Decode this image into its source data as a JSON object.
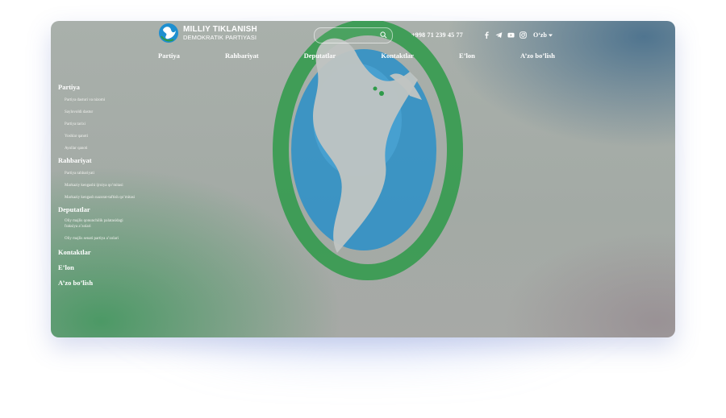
{
  "brand": {
    "name_line1": "MILLIY TIKLANISH",
    "name_line2": "DEMOKRATIK PARTIYASI"
  },
  "header": {
    "search_placeholder": "",
    "phone": "+998 71 239 45 77",
    "socials": [
      "facebook-icon",
      "telegram-icon",
      "youtube-icon",
      "instagram-icon"
    ],
    "language": "O‘zb"
  },
  "nav": {
    "items": [
      "Partiya",
      "Rahbariyat",
      "Deputatlar",
      "Kontaktlar",
      "E’lon",
      "A’zo bo’lish"
    ]
  },
  "sidebar": {
    "sections": [
      {
        "title": "Partiya",
        "items": [
          "Partiya dasturi va nizomi",
          "Saylovoldi dastur",
          "Partiya tarixi",
          "Yoshlar qanoti",
          "Ayollar qanoti"
        ]
      },
      {
        "title": "Rahbariyat",
        "items": [
          "Partiya rahbariyati",
          "Markaziy kengashi ijroiya qo’mitasi",
          "Markaziy kengash nazorat-taftish qo’mitasi"
        ]
      },
      {
        "title": "Deputatlar",
        "items": [
          "Oliy majlis qonunchilik palatasidagi fraksiya a’zolari",
          "Oliy majlis senati partiya a’zolari"
        ]
      },
      {
        "title": "Kontaktlar",
        "items": []
      },
      {
        "title": "E’lon",
        "items": []
      },
      {
        "title": "A’zo bo’lish",
        "items": []
      }
    ]
  },
  "colors": {
    "brand_green": "#2e9a49",
    "brand_blue": "#1e8fd0",
    "text_on_dark": "#ffffff",
    "glow": "#8ea8ec"
  }
}
